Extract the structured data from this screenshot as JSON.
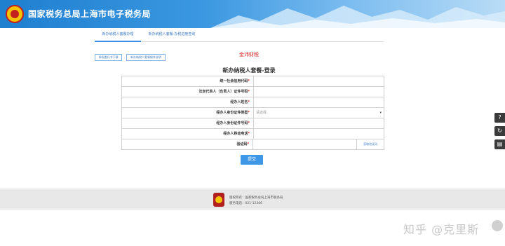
{
  "header": {
    "title": "国家税务总局上海市电子税务局"
  },
  "tabs": [
    {
      "label": "新办纳税人套餐办理"
    },
    {
      "label": "新办纳税人套餐-办税进度查询"
    }
  ],
  "toolbar": {
    "download_label": "授权委托书下载",
    "guide_label": "新办纳税人套餐操作说明"
  },
  "company_name": "金沛财税",
  "form": {
    "title": "新办纳税人套餐-登录",
    "fields": [
      {
        "label": "统一社会信用代码",
        "required": "*",
        "value": ""
      },
      {
        "label": "法定代表人（负责人）证件号码",
        "required": "*",
        "value": ""
      },
      {
        "label": "经办人姓名",
        "required": "*",
        "value": ""
      },
      {
        "label": "经办人身份证件类型",
        "required": "*",
        "value": "请选择"
      },
      {
        "label": "经办人身份证件号码",
        "required": "*",
        "value": ""
      },
      {
        "label": "经办人移动电话",
        "required": "*",
        "value": ""
      },
      {
        "label": "验证码",
        "required": "*",
        "value": ""
      }
    ],
    "captcha_button": "获取验证码",
    "submit_label": "提交"
  },
  "side_tools": [
    "?",
    "↻",
    "▤"
  ],
  "footer": {
    "copyright": "版权所有：国家税务总局上海市税务局",
    "phone": "服务电话：021-12366"
  },
  "watermark": "知乎 @克里斯",
  "colors": {
    "header_blue": "#1f7fd0",
    "accent": "#3f97e8",
    "required": "#d42020"
  }
}
